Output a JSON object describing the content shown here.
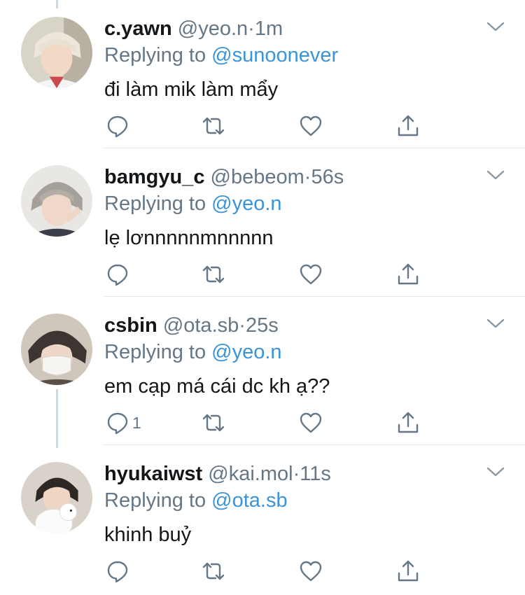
{
  "tweets": [
    {
      "name": "c.yawn",
      "handle": "@yeo.n",
      "time": "1m",
      "replying_prefix": "Replying to",
      "replying_to": "@sunoonever",
      "text": "đi làm mik làm mẩy",
      "reply_count": "",
      "avatar_icon": "avatar-photo"
    },
    {
      "name": "bamgyu_c",
      "handle": "@bebeom",
      "time": "56s",
      "replying_prefix": "Replying to",
      "replying_to": "@yeo.n",
      "text": "lẹ lơnnnnnmnnnnn",
      "reply_count": "",
      "avatar_icon": "avatar-photo"
    },
    {
      "name": "csbin",
      "handle": "@ota.sb",
      "time": "25s",
      "replying_prefix": "Replying to",
      "replying_to": "@yeo.n",
      "text": "em cạp má cái dc kh ạ??",
      "reply_count": "1",
      "avatar_icon": "avatar-photo"
    },
    {
      "name": "hyukaiwst",
      "handle": "@kai.mol",
      "time": "11s",
      "replying_prefix": "Replying to",
      "replying_to": "@ota.sb",
      "text": "khinh buỷ",
      "reply_count": "",
      "avatar_icon": "avatar-photo"
    }
  ],
  "separator": "·",
  "icons": {
    "reply": "reply-icon",
    "retweet": "retweet-icon",
    "like": "heart-icon",
    "share": "share-icon",
    "menu": "chevron-down-icon"
  },
  "colors": {
    "text": "#14171a",
    "secondary": "#657786",
    "accent": "#3b94d9",
    "divider": "#e1e8ed",
    "icon": "#657786"
  }
}
